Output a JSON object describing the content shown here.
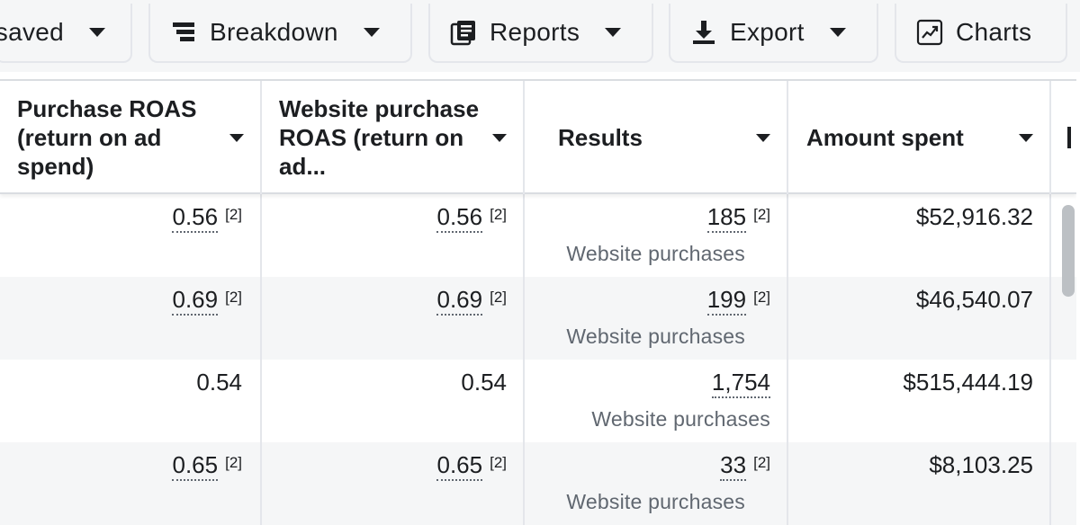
{
  "toolbar": {
    "saved_label": "saved",
    "breakdown_label": "Breakdown",
    "reports_label": "Reports",
    "export_label": "Export",
    "charts_label": "Charts"
  },
  "table": {
    "columns": [
      "Purchase ROAS (return on ad spend)",
      "Website purchase ROAS (return on ad...",
      "Results",
      "Amount spent"
    ],
    "rows": [
      {
        "purchase_roas": "0.56",
        "purchase_roas_note": "[2]",
        "website_roas": "0.56",
        "website_roas_note": "[2]",
        "results": "185",
        "results_note": "[2]",
        "results_type": "Website purchases",
        "amount_spent": "$52,916.32"
      },
      {
        "purchase_roas": "0.69",
        "purchase_roas_note": "[2]",
        "website_roas": "0.69",
        "website_roas_note": "[2]",
        "results": "199",
        "results_note": "[2]",
        "results_type": "Website purchases",
        "amount_spent": "$46,540.07"
      },
      {
        "purchase_roas": "0.54",
        "purchase_roas_note": "",
        "website_roas": "0.54",
        "website_roas_note": "",
        "results": "1,754",
        "results_note": "",
        "results_type": "Website purchases",
        "amount_spent": "$515,444.19"
      },
      {
        "purchase_roas": "0.65",
        "purchase_roas_note": "[2]",
        "website_roas": "0.65",
        "website_roas_note": "[2]",
        "results": "33",
        "results_note": "[2]",
        "results_type": "Website purchases",
        "amount_spent": "$8,103.25"
      }
    ]
  }
}
